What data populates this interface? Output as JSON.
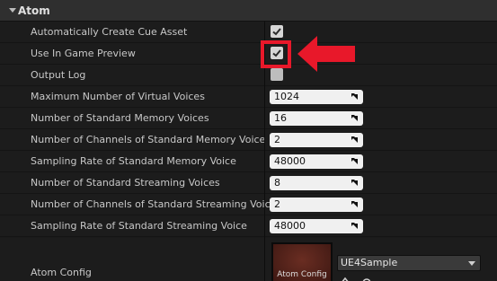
{
  "category": {
    "title": "Atom"
  },
  "rows": [
    {
      "label": "Automatically Create Cue Asset",
      "type": "checkbox",
      "checked": true
    },
    {
      "label": "Use In Game Preview",
      "type": "checkbox",
      "checked": true
    },
    {
      "label": "Output Log",
      "type": "checkbox",
      "checked": false
    },
    {
      "label": "Maximum Number of Virtual Voices",
      "type": "number",
      "value": "1024"
    },
    {
      "label": "Number of Standard Memory Voices",
      "type": "number",
      "value": "16"
    },
    {
      "label": "Number of Channels of Standard Memory Voice",
      "type": "number",
      "value": "2"
    },
    {
      "label": "Sampling Rate of Standard Memory Voice",
      "type": "number",
      "value": "48000"
    },
    {
      "label": "Number of Standard Streaming Voices",
      "type": "number",
      "value": "8"
    },
    {
      "label": "Number of Channels of Standard Streaming Voice",
      "type": "number",
      "value": "2"
    },
    {
      "label": "Sampling Rate of Standard Streaming Voice",
      "type": "number",
      "value": "48000"
    }
  ],
  "atom_config": {
    "label": "Atom Config",
    "thumbnail_label": "Atom Config",
    "asset_value": "UE4Sample"
  },
  "colors": {
    "highlight": "#e8182a",
    "panel_bg": "#1c1c1c",
    "header_bg": "#2f2f2f"
  },
  "icons": {
    "collapse": "triangle-down-icon",
    "check": "checkmark-icon",
    "drag": "drag-resize-icon",
    "annotation_arrow": "left-arrow-icon",
    "combo": "chevron-down-icon"
  }
}
